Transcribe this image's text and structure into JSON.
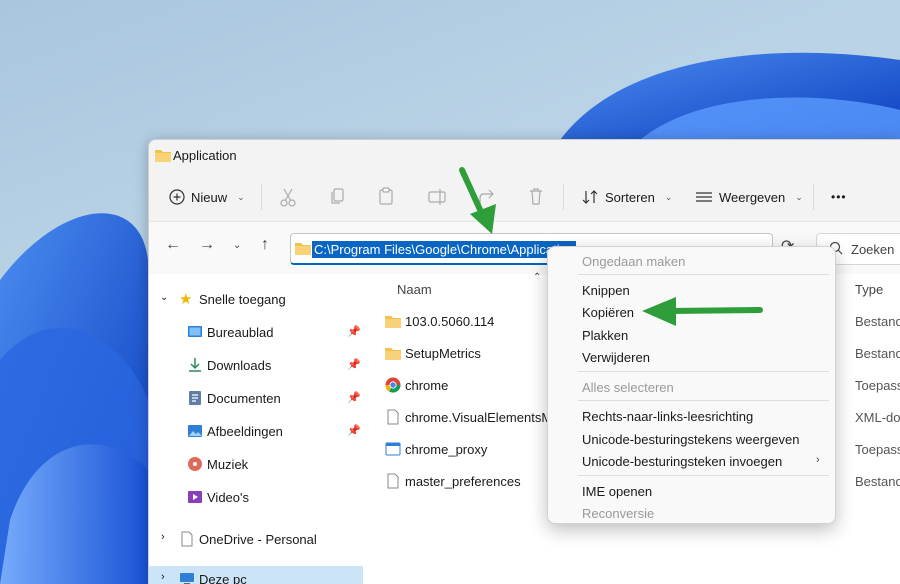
{
  "window": {
    "title": "Application"
  },
  "toolbar": {
    "new_label": "Nieuw",
    "sort_label": "Sorteren",
    "view_label": "Weergeven",
    "more_label": "•••"
  },
  "address": {
    "path": "C:\\Program Files\\Google\\Chrome\\Application"
  },
  "search": {
    "placeholder": "Zoeken"
  },
  "nav": {
    "quick_access": "Snelle toegang",
    "items": [
      "Bureaublad",
      "Downloads",
      "Documenten",
      "Afbeeldingen",
      "Muziek",
      "Video's"
    ],
    "onedrive": "OneDrive - Personal",
    "this_pc": "Deze pc"
  },
  "columns": {
    "name": "Naam",
    "type": "Type"
  },
  "files": [
    {
      "name": "103.0.5060.114",
      "type": "Bestand"
    },
    {
      "name": "SetupMetrics",
      "type": "Bestand"
    },
    {
      "name": "chrome",
      "type": "Toepass"
    },
    {
      "name": "chrome.VisualElementsMa",
      "type": "XML-doc"
    },
    {
      "name": "chrome_proxy",
      "type": "Toepass"
    },
    {
      "name": "master_preferences",
      "type": "Bestand"
    }
  ],
  "context_menu": {
    "undo": "Ongedaan maken",
    "cut": "Knippen",
    "copy": "Kopiëren",
    "paste": "Plakken",
    "delete": "Verwijderen",
    "select_all": "Alles selecteren",
    "rtl": "Rechts-naar-links-leesrichting",
    "show_unicode": "Unicode-besturingstekens weergeven",
    "insert_unicode": "Unicode-besturingsteken invoegen",
    "ime_open": "IME openen",
    "reconversion": "Reconversie"
  },
  "colors": {
    "accent": "#0a66c4",
    "arrow": "#2e9e3a",
    "folder": "#f2c14e"
  }
}
